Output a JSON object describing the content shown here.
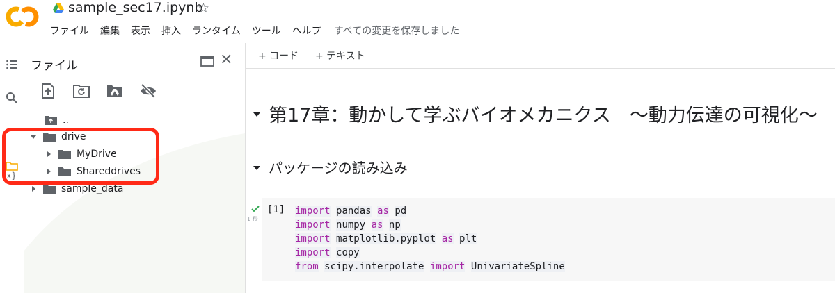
{
  "app": {
    "logo_text": "CO",
    "doc_title": "sample_sec17.ipynb",
    "menu": [
      "ファイル",
      "編集",
      "表示",
      "挿入",
      "ランタイム",
      "ツール",
      "ヘルプ"
    ],
    "save_status": "すべての変更を保存しました"
  },
  "colors": {
    "accent_orange": "#f9ab00",
    "logo_orange": "#ff8f00",
    "highlight_red": "#ff2a17",
    "keyword_purple": "#a626a4"
  },
  "left_rail": {
    "icons": [
      "toc-icon",
      "search-icon",
      "variables-icon",
      "folder-icon"
    ],
    "brace_label": "{x}"
  },
  "file_panel": {
    "title": "ファイル",
    "toolbar": [
      "upload-icon",
      "refresh-icon",
      "mount-drive-icon",
      "hide-icon"
    ],
    "tree": [
      {
        "label": "..",
        "depth": 1
      },
      {
        "label": "drive",
        "depth": 0,
        "expanded": true
      },
      {
        "label": "MyDrive",
        "depth": 1
      },
      {
        "label": "Shareddrives",
        "depth": 1
      },
      {
        "label": "sample_data",
        "depth": 0
      }
    ]
  },
  "notebook": {
    "toolbar": {
      "code": "+ コード",
      "text": "+ テキスト"
    },
    "headings": [
      "第17章：動かして学ぶバイオメカニクス　～動力伝達の可視化～",
      "パッケージの読み込み"
    ],
    "cell": {
      "exec_count": "[1]",
      "exec_time": "1 秒",
      "status": "completed",
      "lines": [
        [
          {
            "t": "kw",
            "v": "import"
          },
          {
            "t": "sp",
            "v": " "
          },
          {
            "t": "id",
            "v": "pandas"
          },
          {
            "t": "sp",
            "v": " "
          },
          {
            "t": "kw",
            "v": "as"
          },
          {
            "t": "sp",
            "v": " "
          },
          {
            "t": "id",
            "v": "pd"
          }
        ],
        [
          {
            "t": "kw",
            "v": "import"
          },
          {
            "t": "sp",
            "v": " "
          },
          {
            "t": "id",
            "v": "numpy"
          },
          {
            "t": "sp",
            "v": " "
          },
          {
            "t": "kw",
            "v": "as"
          },
          {
            "t": "sp",
            "v": " "
          },
          {
            "t": "id",
            "v": "np"
          }
        ],
        [
          {
            "t": "kw",
            "v": "import"
          },
          {
            "t": "sp",
            "v": " "
          },
          {
            "t": "id",
            "v": "matplotlib.pyplot"
          },
          {
            "t": "sp",
            "v": " "
          },
          {
            "t": "kw",
            "v": "as"
          },
          {
            "t": "sp",
            "v": " "
          },
          {
            "t": "id",
            "v": "plt"
          }
        ],
        [
          {
            "t": "kw",
            "v": "import"
          },
          {
            "t": "sp",
            "v": " "
          },
          {
            "t": "id",
            "v": "copy"
          }
        ],
        [
          {
            "t": "kw",
            "v": "from"
          },
          {
            "t": "sp",
            "v": " "
          },
          {
            "t": "id",
            "v": "scipy.interpolate"
          },
          {
            "t": "sp",
            "v": " "
          },
          {
            "t": "kw",
            "v": "import"
          },
          {
            "t": "sp",
            "v": " "
          },
          {
            "t": "id",
            "v": "UnivariateSpline"
          }
        ]
      ]
    }
  }
}
